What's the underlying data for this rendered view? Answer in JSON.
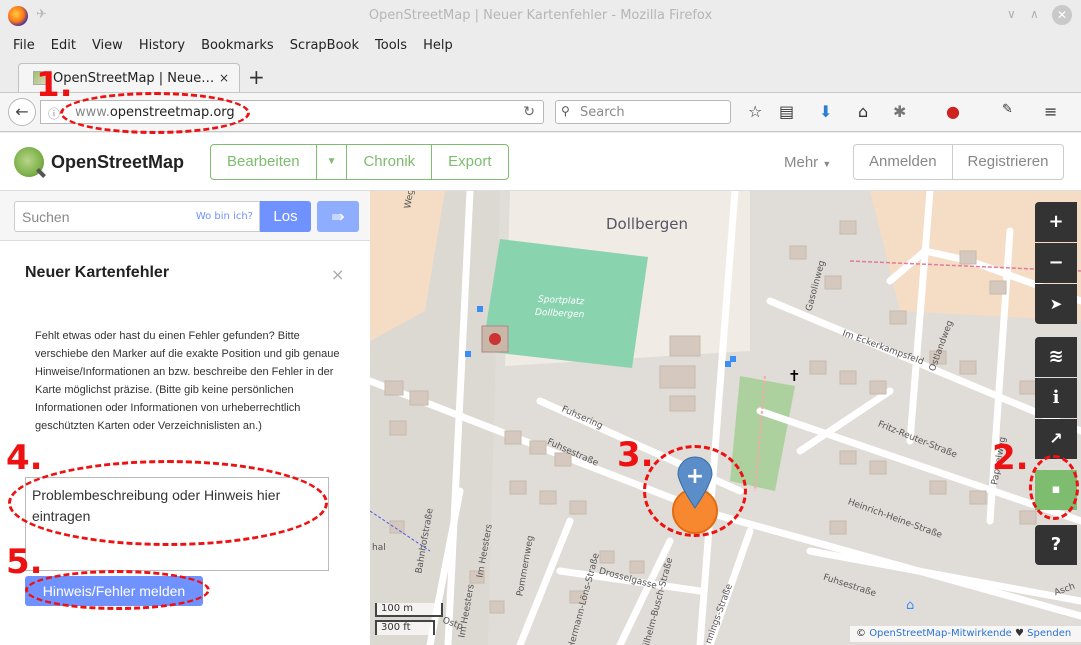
{
  "window": {
    "title": "OpenStreetMap | Neuer Kartenfehler - Mozilla Firefox"
  },
  "menu": [
    "File",
    "Edit",
    "View",
    "History",
    "Bookmarks",
    "ScrapBook",
    "Tools",
    "Help"
  ],
  "tab": {
    "label": "OpenStreetMap | Neue…",
    "close": "×",
    "new": "+"
  },
  "address": {
    "prefix": "www.",
    "domain": "openstreetmap.org",
    "search_placeholder": "Search"
  },
  "osm": {
    "brand": "OpenStreetMap",
    "edit": "Bearbeiten",
    "history": "Chronik",
    "export": "Export",
    "more": "Mehr",
    "login": "Anmelden",
    "register": "Registrieren"
  },
  "search": {
    "placeholder": "Suchen",
    "where": "Wo bin ich?",
    "go": "Los"
  },
  "panel": {
    "title": "Neuer Kartenfehler",
    "close": "×",
    "text": "Fehlt etwas oder hast du einen Fehler gefunden? Bitte verschiebe den Marker auf die exakte Position und gib genaue Hinweise/Informationen an bzw. beschreibe den Fehler in der Karte möglichst präzise. (Bitte gib keine persönlichen Informationen oder Informationen von urheberrechtlich geschützten Karten oder Verzeichnislisten an.)",
    "textarea_placeholder": "Problembeschreibung oder Hinweis hier eintragen",
    "submit": "Hinweis/Fehler melden"
  },
  "map": {
    "labels": {
      "town": "Dollbergen",
      "sport": "Sportplatz",
      "sport2": "Dollbergen",
      "fuhsering": "Fuhsering",
      "fuhsestrasse": "Fuhsestraße",
      "fuhsestrasse2": "Fuhsestraße",
      "gasolinweg": "Gasolinweg",
      "eckerkamp": "Im Eckerkampsfeld",
      "ostlandweg": "Ostlandweg",
      "fritzreuter": "Fritz-Reuter-Straße",
      "pappelweg": "Pappelweg",
      "heinrichheine": "Heinrich-Heine-Straße",
      "bahnhof": "Bahnhofstraße",
      "heesters": "Im Heesters",
      "heesters2": "Im Heesters",
      "pommernweg": "Pommernweg",
      "loens": "Hermann-Löns-Straße",
      "busch": "Wilhelm-Busch-Straße",
      "drossel": "Drosselgasse",
      "weg": "Weg",
      "hal": "hal",
      "ostp": "Ostp",
      "asch": "Asch",
      "jennings": "nnings-Straße"
    },
    "scale": {
      "metric": "100 m",
      "imperial": "300 ft"
    },
    "attribution": {
      "prefix": "© ",
      "link": "OpenStreetMap-Mitwirkende",
      "heart": " ♥ ",
      "donate": "Spenden"
    }
  },
  "controls": {
    "zoom_in": "+",
    "zoom_out": "−",
    "locate": "➤",
    "layers": "≋",
    "info": "i",
    "share": "↗",
    "note": "▪",
    "help": "?"
  },
  "annotations": [
    "1.",
    "2.",
    "3.",
    "4.",
    "5."
  ],
  "colors": {
    "osm_green": "#7ebc6f",
    "osm_blue": "#7092ff",
    "annotation_red": "#ee1111",
    "note_button": "#7ebc6f",
    "marker_orange": "#f7882f"
  }
}
